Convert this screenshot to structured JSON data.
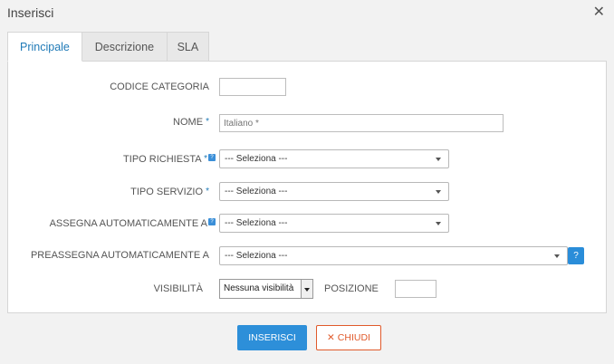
{
  "dialog": {
    "title": "Inserisci",
    "close_glyph": "✕"
  },
  "tabs": [
    {
      "label": "Principale",
      "active": true
    },
    {
      "label": "Descrizione",
      "active": false
    },
    {
      "label": "SLA",
      "active": false
    }
  ],
  "form": {
    "codice_categoria": {
      "label": "CODICE CATEGORIA",
      "value": ""
    },
    "nome": {
      "label": "NOME",
      "required_mark": "*",
      "placeholder": "Italiano *"
    },
    "tipo_richiesta": {
      "label": "TIPO RICHIESTA",
      "required_mark": "*",
      "help_mark": "?",
      "selected": "--- Seleziona ---"
    },
    "tipo_servizio": {
      "label": "TIPO SERVIZIO",
      "required_mark": "*",
      "selected": "--- Seleziona ---"
    },
    "assegna": {
      "label": "ASSEGNA AUTOMATICAMENTE A",
      "help_mark": "?",
      "selected": "--- Seleziona ---"
    },
    "preassegna": {
      "label": "PREASSEGNA AUTOMATICAMENTE A",
      "selected": "--- Seleziona ---",
      "help_button": "?"
    },
    "visibilita": {
      "label": "VISIBILITÀ",
      "selected": "Nessuna visibilità"
    },
    "posizione": {
      "label": "POSIZIONE",
      "value": ""
    }
  },
  "footer": {
    "submit_label": "INSERISCI",
    "close_label": "CHIUDI",
    "close_icon": "✕"
  },
  "colors": {
    "accent": "#2d8fd9",
    "danger": "#e05a2b",
    "background": "#f2f2f2"
  }
}
